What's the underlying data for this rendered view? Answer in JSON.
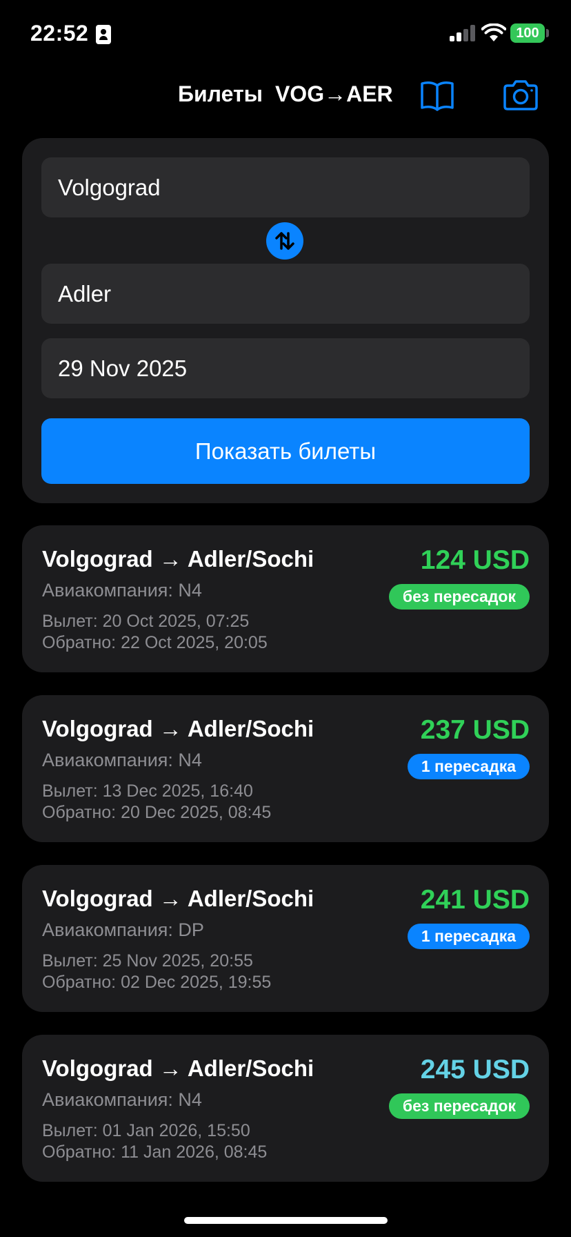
{
  "status_bar": {
    "time": "22:52",
    "battery": "100",
    "icons": [
      "id-card-icon",
      "cellular-signal-icon",
      "wifi-icon",
      "battery-icon"
    ]
  },
  "nav": {
    "title": "Билеты",
    "route_code": "VOG→AER",
    "icons": [
      "book-icon",
      "camera-icon"
    ]
  },
  "search": {
    "from": "Volgograd",
    "to": "Adler",
    "date": "29 Nov 2025",
    "swap_icon": "swap-arrows-icon",
    "submit_label": "Показать билеты"
  },
  "results": [
    {
      "route": "Volgograd → Adler/Sochi",
      "airline": "Авиакомпания: N4",
      "departure": "Вылет: 20 Oct 2025, 07:25",
      "return": "Обратно: 22 Oct 2025, 20:05",
      "price": "124 USD",
      "price_color": "#30d158",
      "badge": "без пересадок",
      "badge_color": "#30c759"
    },
    {
      "route": "Volgograd → Adler/Sochi",
      "airline": "Авиакомпания: N4",
      "departure": "Вылет: 13 Dec 2025, 16:40",
      "return": "Обратно: 20 Dec 2025, 08:45",
      "price": "237 USD",
      "price_color": "#30d158",
      "badge": "1 пересадка",
      "badge_color": "#0a84ff"
    },
    {
      "route": "Volgograd → Adler/Sochi",
      "airline": "Авиакомпания: DP",
      "departure": "Вылет: 25 Nov 2025, 20:55",
      "return": "Обратно: 02 Dec 2025, 19:55",
      "price": "241 USD",
      "price_color": "#30d158",
      "badge": "1 пересадка",
      "badge_color": "#0a84ff"
    },
    {
      "route": "Volgograd → Adler/Sochi",
      "airline": "Авиакомпания: N4",
      "departure": "Вылет: 01 Jan 2026, 15:50",
      "return": "Обратно: 11 Jan 2026, 08:45",
      "price": "245 USD",
      "price_color": "#64d2e6",
      "badge": "без пересадок",
      "badge_color": "#30c759"
    }
  ],
  "colors": {
    "accent": "#0a84ff",
    "background": "#000000",
    "card": "#1c1c1e",
    "field": "#2c2c2e",
    "secondary_text": "#8e8e93"
  }
}
